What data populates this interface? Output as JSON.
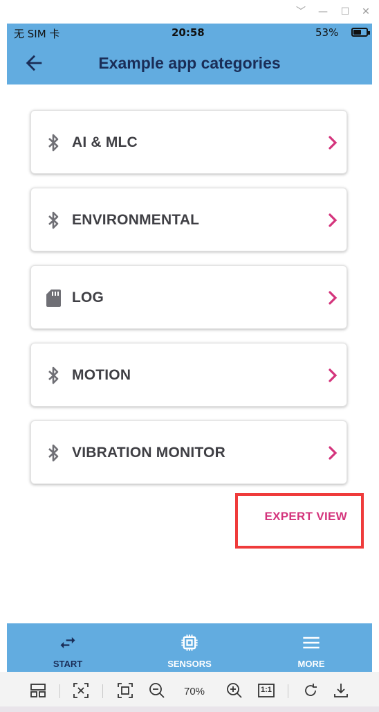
{
  "window": {
    "controls": {
      "collapse": "﹀",
      "minimize": "—",
      "maximize": "☐",
      "close": "✕"
    }
  },
  "status_bar": {
    "carrier": "无 SIM 卡",
    "time": "20:58",
    "battery_text": "53%",
    "battery_level": 0.53
  },
  "app_bar": {
    "title": "Example app categories",
    "back_icon": "arrow-left-icon"
  },
  "categories": [
    {
      "label": "AI & MLC",
      "icon": "bluetooth-icon"
    },
    {
      "label": "ENVIRONMENTAL",
      "icon": "bluetooth-icon"
    },
    {
      "label": "LOG",
      "icon": "sd-card-icon"
    },
    {
      "label": "MOTION",
      "icon": "bluetooth-icon"
    },
    {
      "label": "VIBRATION MONITOR",
      "icon": "bluetooth-icon"
    }
  ],
  "expert_view": {
    "label": "EXPERT VIEW"
  },
  "bottom_nav": [
    {
      "label": "START",
      "icon": "swap-arrows-icon",
      "active": true
    },
    {
      "label": "SENSORS",
      "icon": "chip-icon",
      "active": false
    },
    {
      "label": "MORE",
      "icon": "menu-icon",
      "active": false
    }
  ],
  "emulator_toolbar": {
    "zoom": "70%",
    "ratio_label": "1:1"
  },
  "colors": {
    "primary": "#62ace0",
    "title_text": "#1a2d57",
    "accent": "#d4347c",
    "nav_active": "#1a2d57",
    "nav_inactive": "#ffffff",
    "highlight_box": "#ef3b3b"
  }
}
